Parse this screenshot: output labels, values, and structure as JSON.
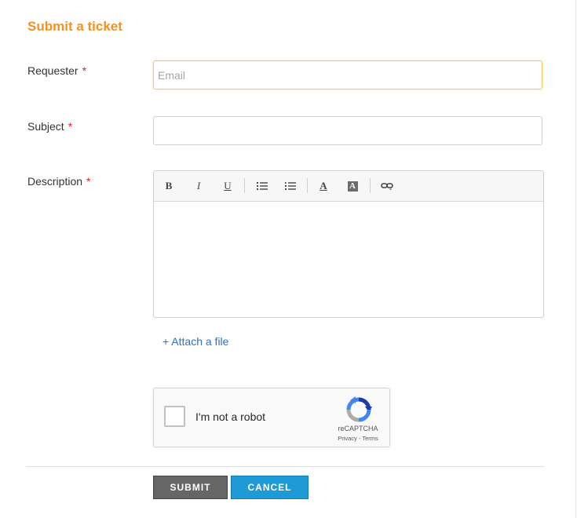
{
  "form": {
    "title": "Submit a ticket",
    "requester": {
      "label": "Requester",
      "required_mark": "*",
      "placeholder": "Email",
      "value": ""
    },
    "subject": {
      "label": "Subject",
      "required_mark": "*",
      "value": ""
    },
    "description": {
      "label": "Description",
      "required_mark": "*",
      "value": ""
    },
    "toolbar": {
      "bold": "B",
      "italic": "I",
      "underline": "U",
      "bulleted_list_icon": "bulleted-list-icon",
      "numbered_list_icon": "numbered-list-icon",
      "font_color": "A",
      "highlight": "A",
      "link_icon": "link-icon"
    },
    "attach_label": "+ Attach a file",
    "captcha": {
      "label": "I'm not a robot",
      "brand": "reCAPTCHA",
      "privacy": "Privacy",
      "separator": " - ",
      "terms": "Terms"
    },
    "buttons": {
      "submit": "SUBMIT",
      "cancel": "CANCEL"
    },
    "colors": {
      "title": "#f39224",
      "required": "#e02020",
      "link": "#2d72c4",
      "submit_bg": "#666666",
      "cancel_bg": "#1e9ad6"
    }
  }
}
